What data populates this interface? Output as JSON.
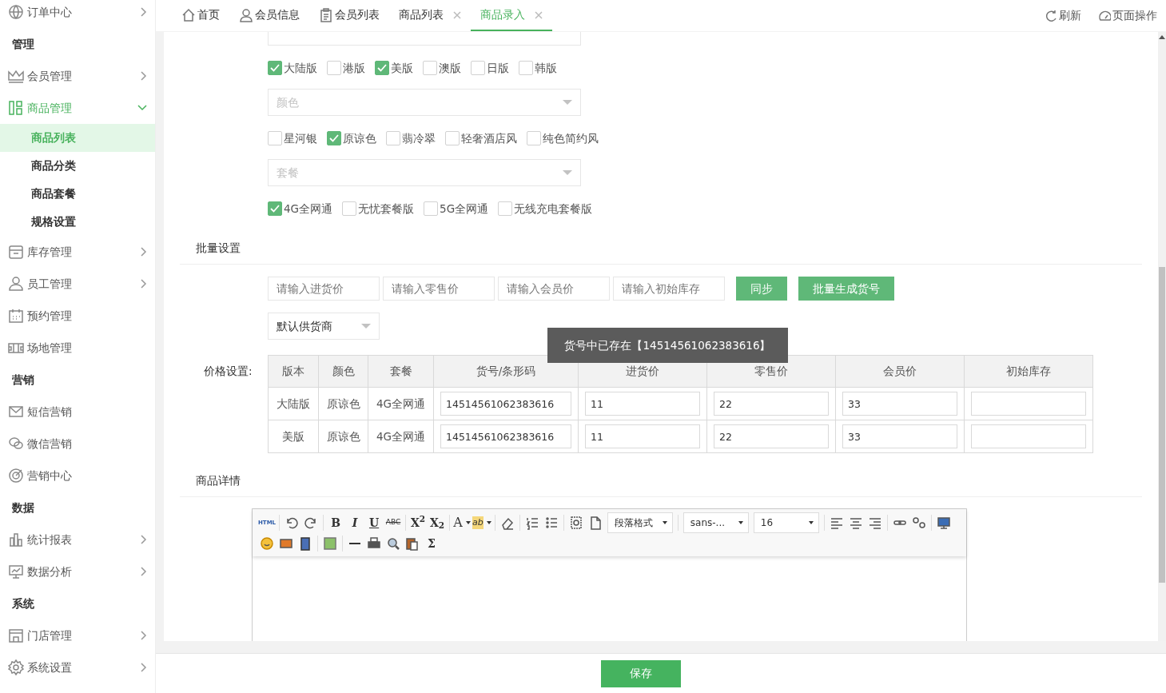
{
  "sidebar": {
    "items": [
      {
        "kind": "group",
        "label": "订单中心",
        "arrow": true,
        "expanded": false
      },
      {
        "kind": "header",
        "label": "管理"
      },
      {
        "kind": "group",
        "label": "会员管理",
        "arrow": true,
        "expanded": false
      },
      {
        "kind": "group",
        "label": "商品管理",
        "arrow": true,
        "expanded": true,
        "children": [
          {
            "label": "商品列表",
            "selected": true
          },
          {
            "label": "商品分类",
            "selected": false
          },
          {
            "label": "商品套餐",
            "selected": false
          },
          {
            "label": "规格设置",
            "selected": false
          }
        ]
      },
      {
        "kind": "group",
        "label": "库存管理",
        "arrow": true,
        "expanded": false
      },
      {
        "kind": "group",
        "label": "员工管理",
        "arrow": true,
        "expanded": false
      },
      {
        "kind": "group",
        "label": "预约管理",
        "arrow": false,
        "expanded": false
      },
      {
        "kind": "group",
        "label": "场地管理",
        "arrow": false,
        "expanded": false
      },
      {
        "kind": "header",
        "label": "营销"
      },
      {
        "kind": "group",
        "label": "短信营销",
        "arrow": false,
        "expanded": false
      },
      {
        "kind": "group",
        "label": "微信营销",
        "arrow": false,
        "expanded": false
      },
      {
        "kind": "group",
        "label": "营销中心",
        "arrow": false,
        "expanded": false
      },
      {
        "kind": "header",
        "label": "数据"
      },
      {
        "kind": "group",
        "label": "统计报表",
        "arrow": true,
        "expanded": false
      },
      {
        "kind": "group",
        "label": "数据分析",
        "arrow": true,
        "expanded": false
      },
      {
        "kind": "header",
        "label": "系统"
      },
      {
        "kind": "group",
        "label": "门店管理",
        "arrow": true,
        "expanded": false
      },
      {
        "kind": "group",
        "label": "系统设置",
        "arrow": true,
        "expanded": false
      }
    ]
  },
  "tabs": [
    {
      "label": "首页",
      "selected": false,
      "closable": false
    },
    {
      "label": "会员信息",
      "selected": false,
      "closable": false
    },
    {
      "label": "会员列表",
      "selected": false,
      "closable": false
    },
    {
      "label": "商品列表",
      "selected": false,
      "closable": true
    },
    {
      "label": "商品录入",
      "selected": true,
      "closable": true
    }
  ],
  "tab_actions": [
    "刷新",
    "页面操作"
  ],
  "spec_groups": [
    {
      "options": [
        {
          "label": "大陆版",
          "checked": true
        },
        {
          "label": "港版",
          "checked": false
        },
        {
          "label": "美版",
          "checked": true
        },
        {
          "label": "澳版",
          "checked": false
        },
        {
          "label": "日版",
          "checked": false
        },
        {
          "label": "韩版",
          "checked": false
        }
      ]
    },
    {
      "placeholder": "颜色",
      "options": [
        {
          "label": "星河银",
          "checked": false
        },
        {
          "label": "原谅色",
          "checked": true
        },
        {
          "label": "翡冷翠",
          "checked": false
        },
        {
          "label": "轻奢酒店风",
          "checked": false
        },
        {
          "label": "纯色简约风",
          "checked": false
        }
      ]
    },
    {
      "placeholder": "套餐",
      "options": [
        {
          "label": "4G全网通",
          "checked": true
        },
        {
          "label": "无忧套餐版",
          "checked": false
        },
        {
          "label": "5G全网通",
          "checked": false
        },
        {
          "label": "无线充电套餐版",
          "checked": false
        }
      ]
    }
  ],
  "batch": {
    "title": "批量设置",
    "fields": [
      {
        "placeholder": "请输入进货价"
      },
      {
        "placeholder": "请输入零售价"
      },
      {
        "placeholder": "请输入会员价"
      },
      {
        "placeholder": "请输入初始库存"
      }
    ],
    "buttons": [
      "同步",
      "批量生成货号"
    ],
    "supplier": "默认供货商"
  },
  "price": {
    "label": "价格设置:",
    "columns": [
      "版本",
      "颜色",
      "套餐",
      "货号/条形码",
      "进货价",
      "零售价",
      "会员价",
      "初始库存"
    ],
    "rows": [
      {
        "cells": [
          "大陆版",
          "原谅色",
          "4G全网通"
        ],
        "inputs": [
          "14514561062383616",
          "11",
          "22",
          "33"
        ]
      },
      {
        "cells": [
          "美版",
          "原谅色",
          "4G全网通"
        ],
        "inputs": [
          "14514561062383616",
          "11",
          "22",
          "33"
        ]
      }
    ],
    "tooltip": "货号中已存在【14514561062383616】"
  },
  "detail": {
    "title": "商品详情",
    "toolbar": [
      [
        {
          "kind": "tiny",
          "label": "HTML"
        },
        {
          "kind": "sep"
        },
        {
          "kind": "icon"
        },
        {
          "kind": "icon"
        },
        {
          "kind": "sep"
        },
        {
          "kind": "bold",
          "label": "B"
        },
        {
          "kind": "italic",
          "label": "I"
        },
        {
          "kind": "underline",
          "label": "U"
        },
        {
          "kind": "strike",
          "label": "ABC"
        },
        {
          "kind": "sep"
        },
        {
          "kind": "bold",
          "label": "X$^{2}$"
        },
        {
          "kind": "bold",
          "label": "X$_{2}$"
        },
        {
          "kind": "sep"
        },
        {
          "kind": "serif",
          "label": "A",
          "dropdown": true
        },
        {
          "kind": "highlight",
          "label": "ab",
          "dropdown": true
        },
        {
          "kind": "sep"
        },
        {
          "kind": "icon"
        },
        {
          "kind": "sep"
        },
        {
          "kind": "icon"
        },
        {
          "kind": "icon"
        },
        {
          "kind": "sep"
        },
        {
          "kind": "icon"
        },
        {
          "kind": "icon"
        },
        {
          "kind": "select",
          "label": "段落格式"
        },
        {
          "kind": "sep"
        },
        {
          "kind": "select",
          "label": "sans-..."
        },
        {
          "kind": "select",
          "label": "16"
        },
        {
          "kind": "sep"
        },
        {
          "kind": "icon"
        },
        {
          "kind": "icon"
        },
        {
          "kind": "icon"
        },
        {
          "kind": "sep"
        },
        {
          "kind": "icon"
        },
        {
          "kind": "icon"
        },
        {
          "kind": "sep"
        },
        {
          "kind": "icon"
        }
      ],
      [
        {
          "kind": "icon"
        },
        {
          "kind": "icon"
        },
        {
          "kind": "icon"
        },
        {
          "kind": "sep"
        },
        {
          "kind": "icon"
        },
        {
          "kind": "sep"
        },
        {
          "kind": "icon"
        },
        {
          "kind": "icon"
        },
        {
          "kind": "icon"
        },
        {
          "kind": "icon"
        },
        {
          "kind": "bold",
          "label": "Σ"
        }
      ]
    ]
  },
  "save_button": "保存"
}
